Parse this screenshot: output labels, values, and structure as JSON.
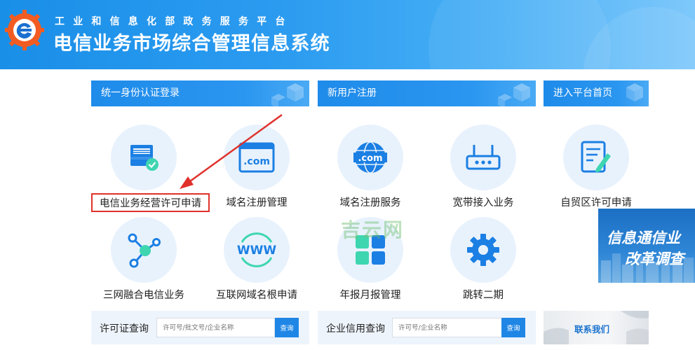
{
  "header": {
    "subtitle": "工业和信息化部政务服务平台",
    "title": "电信业务市场综合管理信息系统"
  },
  "sections": {
    "login": "统一身份认证登录",
    "register": "新用户注册",
    "home": "进入平台首页"
  },
  "services": {
    "telecom_license": "电信业务经营许可申请",
    "domain_mgmt": "域名注册管理",
    "domain_service": "域名注册服务",
    "broadband": "宽带接入业务",
    "ftz_license": "自贸区许可申请",
    "triple_play": "三网融合电信业务",
    "root_domain": "互联网域名根申请",
    "annual_report": "年报月报管理",
    "phase2": "跳转二期"
  },
  "watermark": "吉云网",
  "promo": {
    "line1": "信息通信业",
    "line2": "改革调查"
  },
  "query": {
    "license_label": "许可证查询",
    "license_placeholder": "许可号/批文号/企业名称",
    "license_button": "查询",
    "credit_label": "企业信用查询",
    "credit_placeholder": "许可号/企业名称",
    "credit_button": "查询"
  },
  "contact": "联系我们",
  "colors": {
    "primary": "#1f86e6",
    "highlight": "#e0312b",
    "icon_blue": "#1b7fe3",
    "icon_teal": "#3ed6b0"
  }
}
